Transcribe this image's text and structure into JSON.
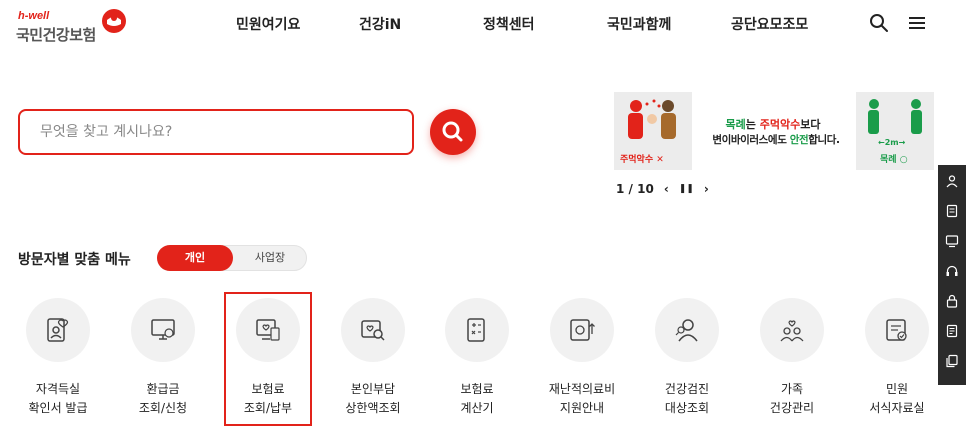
{
  "header": {
    "logo_en": "h-well",
    "logo_ko": "국민건강보험",
    "nav": [
      "민원여기요",
      "건강iN",
      "정책센터",
      "국민과함께",
      "공단요모조모"
    ],
    "icons": [
      "search-icon",
      "hamburger-menu-icon"
    ]
  },
  "search": {
    "placeholder": "무엇을 찾고 계시나요?"
  },
  "banner": {
    "line1_a": "목례",
    "line1_b": "는 ",
    "line1_c": "주먹악수",
    "line1_d": "보다",
    "line2_a": "변이바이러스에도 ",
    "line2_b": "안전",
    "line2_c": "합니다.",
    "caption_left": "주먹악수 ✕",
    "caption_right": "목례 ○",
    "distance": "←2m→",
    "page_current": "1",
    "page_total": "10",
    "controls": [
      "‹",
      "❚❚",
      "›"
    ]
  },
  "visitor": {
    "title": "방문자별 맞춤 메뉴",
    "tabs": [
      "개인",
      "사업장"
    ],
    "active_tab": "개인"
  },
  "menu": [
    {
      "icon": "certificate-icon",
      "l1": "자격득실",
      "l2": "확인서 발급"
    },
    {
      "icon": "refund-icon",
      "l1": "환급금",
      "l2": "조회/신청"
    },
    {
      "icon": "insurance-payment-icon",
      "l1": "보험료",
      "l2": "조회/납부"
    },
    {
      "icon": "copay-search-icon",
      "l1": "본인부담",
      "l2": "상한액조회"
    },
    {
      "icon": "calculator-icon",
      "l1": "보험료",
      "l2": "계산기"
    },
    {
      "icon": "disaster-support-icon",
      "l1": "재난적의료비",
      "l2": "지원안내"
    },
    {
      "icon": "health-checkup-icon",
      "l1": "건강검진",
      "l2": "대상조회"
    },
    {
      "icon": "family-health-icon",
      "l1": "가족",
      "l2": "건강관리"
    },
    {
      "icon": "forms-icon",
      "l1": "민원",
      "l2": "서식자료실"
    }
  ],
  "sidebar": [
    "user-icon",
    "document-icon",
    "monitor-icon",
    "headset-icon",
    "lock-icon",
    "notice-icon",
    "copy-icon"
  ],
  "colors": {
    "accent": "#e2231a",
    "green": "#1a9c4a",
    "icon_bg": "#f1f1f1",
    "sidebar_bg": "#2b2b2b"
  }
}
